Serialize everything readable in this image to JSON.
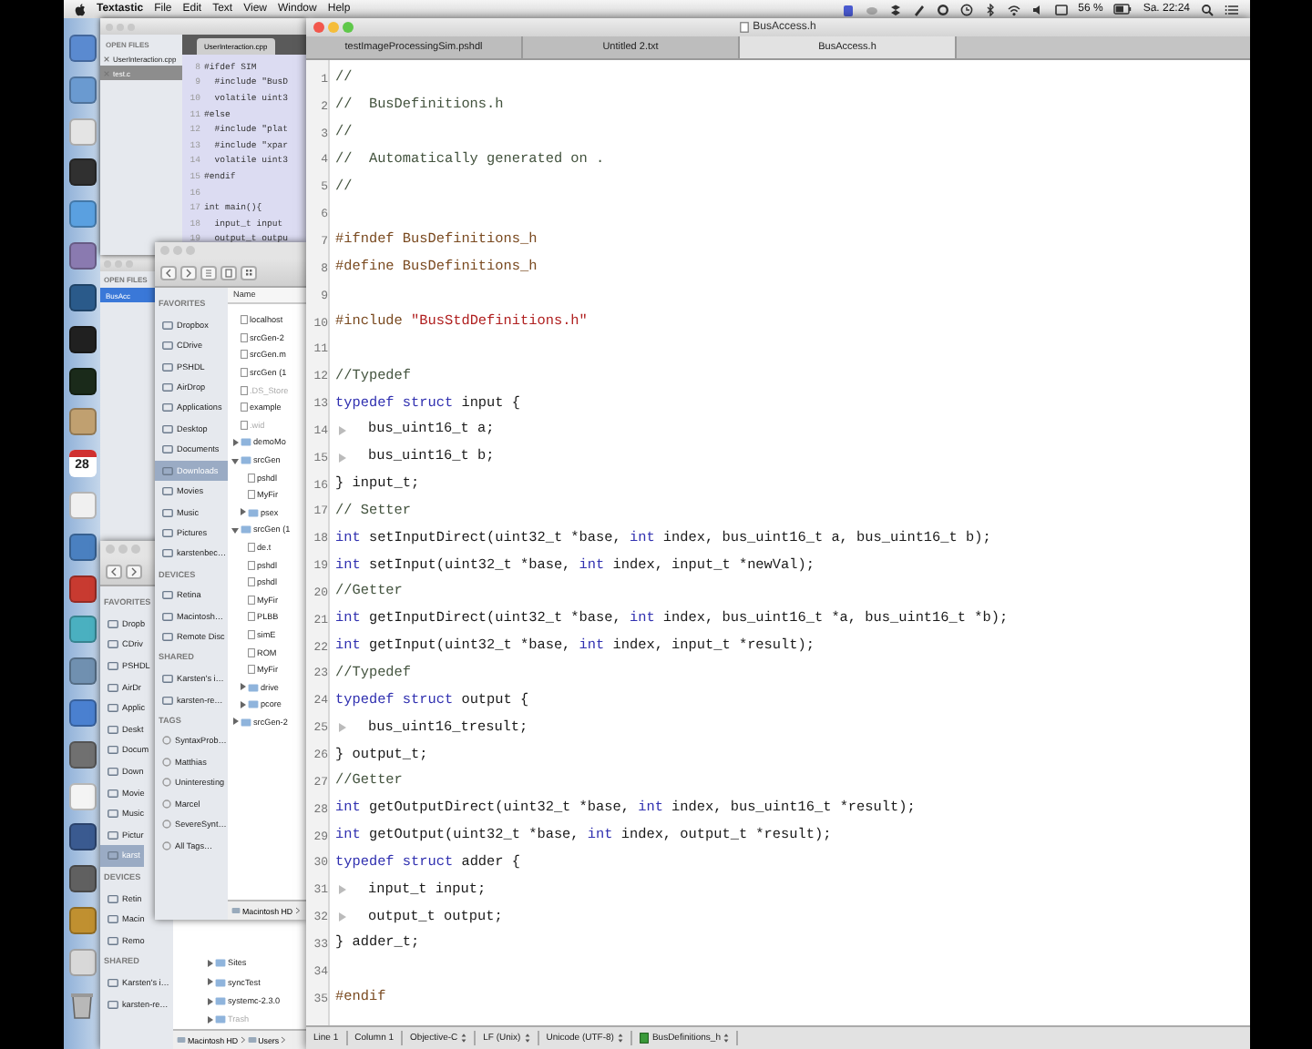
{
  "menu_bar": {
    "app": "Textastic",
    "menus": [
      "File",
      "Edit",
      "Text",
      "View",
      "Window",
      "Help"
    ],
    "battery": "56 %",
    "clock": "Sa. 22:24"
  },
  "dock": {
    "items": [
      {
        "kind": "app",
        "color": "#5a8ad0"
      },
      {
        "kind": "app",
        "color": "#6a9ad0"
      },
      {
        "kind": "app",
        "color": "#e4e4e4"
      },
      {
        "kind": "app",
        "color": "#303030"
      },
      {
        "kind": "app",
        "color": "#5aa0e0"
      },
      {
        "kind": "app",
        "color": "#8a7ab0"
      },
      {
        "kind": "app",
        "color": "#2a5a8a"
      },
      {
        "kind": "app",
        "color": "#202020"
      },
      {
        "kind": "app",
        "color": "#1a2a1a"
      },
      {
        "kind": "app",
        "color": "#c0a070"
      },
      {
        "kind": "calendar",
        "color": "#d03030",
        "text": "28"
      },
      {
        "kind": "app",
        "color": "#f0f0f0"
      },
      {
        "kind": "app",
        "color": "#4a80c0"
      },
      {
        "kind": "app",
        "color": "#c83a30"
      },
      {
        "kind": "app",
        "color": "#4ab0c0"
      },
      {
        "kind": "app",
        "color": "#7090b0"
      },
      {
        "kind": "app",
        "color": "#4a80d0"
      },
      {
        "kind": "app",
        "color": "#707070"
      },
      {
        "kind": "app",
        "color": "#f4f4f4"
      },
      {
        "kind": "app",
        "color": "#3a5a90"
      },
      {
        "kind": "app",
        "color": "#606060"
      },
      {
        "kind": "app",
        "color": "#c09030"
      },
      {
        "kind": "app",
        "color": "#d8d8d8"
      },
      {
        "kind": "trash",
        "color": "#b8b8b8"
      }
    ]
  },
  "background_editor": {
    "sidebar_title": "OPEN FILES",
    "open_files": [
      {
        "name": "UserInteraction.cpp",
        "selected": false
      },
      {
        "name": "test.c",
        "selected": true
      }
    ],
    "tab": "UserInteraction.cpp",
    "lines": [
      {
        "number": "8",
        "text": "#ifdef SIM"
      },
      {
        "number": "9",
        "text": "  #include \"BusD"
      },
      {
        "number": "10",
        "text": "  volatile uint3"
      },
      {
        "number": "11",
        "text": "#else"
      },
      {
        "number": "12",
        "text": "  #include \"plat"
      },
      {
        "number": "13",
        "text": "  #include \"xpar"
      },
      {
        "number": "14",
        "text": "  volatile uint3"
      },
      {
        "number": "15",
        "text": "#endif"
      },
      {
        "number": "16"
      },
      {
        "number": "17",
        "text": "int main(){"
      },
      {
        "number": "18",
        "text": "  input_t input"
      },
      {
        "number": "19",
        "text": "  output_t outpu"
      }
    ]
  },
  "side_window": {
    "sidebar_title": "OPEN FILES",
    "open_files": [
      {
        "name": "BusAcc",
        "selected": true
      }
    ]
  },
  "finder_back": {
    "sections": [
      {
        "title": "FAVORITES",
        "kind": "places",
        "items": [
          {
            "name": "Dropb",
            "selected": false
          },
          {
            "name": "CDriv",
            "selected": false
          },
          {
            "name": "PSHDL",
            "selected": false
          },
          {
            "name": "AirDr",
            "selected": false
          },
          {
            "name": "Applic",
            "selected": false
          },
          {
            "name": "Deskt",
            "selected": false
          },
          {
            "name": "Docum",
            "selected": false
          },
          {
            "name": "Down",
            "selected": false
          },
          {
            "name": "Movie",
            "selected": false
          },
          {
            "name": "Music",
            "selected": false
          },
          {
            "name": "Pictur",
            "selected": false
          },
          {
            "name": "karst",
            "selected": true
          }
        ]
      },
      {
        "title": "DEVICES",
        "kind": "places",
        "items": [
          {
            "name": "Retin",
            "selected": false
          },
          {
            "name": "Macin",
            "selected": false
          },
          {
            "name": "Remo",
            "selected": false
          }
        ]
      },
      {
        "title": "SHARED",
        "kind": "places",
        "items": [
          {
            "name": "Karsten's i…",
            "selected": false
          },
          {
            "name": "karsten-re…",
            "selected": false
          }
        ]
      }
    ],
    "files": [
      {
        "name": "Sites",
        "kind": "folder",
        "expanded": false,
        "dimmed": false
      },
      {
        "name": "syncTest",
        "kind": "folder",
        "expanded": false,
        "dimmed": false
      },
      {
        "name": "systemc-2.3.0",
        "kind": "folder",
        "expanded": false,
        "dimmed": false
      },
      {
        "name": "Trash",
        "kind": "folder",
        "expanded": false,
        "dimmed": true
      }
    ],
    "path": [
      "Macintosh HD",
      "Users"
    ]
  },
  "finder_front": {
    "sections": [
      {
        "title": "FAVORITES",
        "kind": "places",
        "items": [
          {
            "name": "Dropbox",
            "selected": false
          },
          {
            "name": "CDrive",
            "selected": false
          },
          {
            "name": "PSHDL",
            "selected": false
          },
          {
            "name": "AirDrop",
            "selected": false
          },
          {
            "name": "Applications",
            "selected": false
          },
          {
            "name": "Desktop",
            "selected": false
          },
          {
            "name": "Documents",
            "selected": false
          },
          {
            "name": "Downloads",
            "selected": true
          },
          {
            "name": "Movies",
            "selected": false
          },
          {
            "name": "Music",
            "selected": false
          },
          {
            "name": "Pictures",
            "selected": false
          },
          {
            "name": "karstenbec…",
            "selected": false
          }
        ]
      },
      {
        "title": "DEVICES",
        "kind": "places",
        "items": [
          {
            "name": "Retina",
            "selected": false
          },
          {
            "name": "Macintosh…",
            "selected": false
          },
          {
            "name": "Remote Disc",
            "selected": false
          }
        ]
      },
      {
        "title": "SHARED",
        "kind": "places",
        "items": [
          {
            "name": "Karsten's i…",
            "selected": false
          },
          {
            "name": "karsten-re…",
            "selected": false
          }
        ]
      },
      {
        "title": "TAGS",
        "kind": "tags",
        "items": [
          {
            "name": "SyntaxProb…",
            "selected": false
          },
          {
            "name": "Matthias",
            "selected": false
          },
          {
            "name": "Uninteresting",
            "selected": false
          },
          {
            "name": "Marcel",
            "selected": false
          },
          {
            "name": "SevereSynt…",
            "selected": false
          },
          {
            "name": "All Tags…",
            "selected": false
          }
        ]
      }
    ],
    "column_header": "Name",
    "files": [
      {
        "name": "localhost",
        "kind": "file",
        "dimmed": false
      },
      {
        "name": "srcGen-2",
        "kind": "file",
        "dimmed": false
      },
      {
        "name": "srcGen.m",
        "kind": "file",
        "dimmed": false
      },
      {
        "name": "srcGen (1",
        "kind": "file",
        "dimmed": false
      },
      {
        "name": ".DS_Store",
        "kind": "file",
        "dimmed": true
      },
      {
        "name": "example",
        "kind": "file",
        "dimmed": false
      },
      {
        "name": ".wid",
        "kind": "file",
        "dimmed": true
      },
      {
        "name": "demoMo",
        "kind": "folder",
        "expanded": false,
        "dimmed": false
      },
      {
        "name": "srcGen",
        "kind": "folder",
        "expanded": true,
        "dimmed": false,
        "children": [
          {
            "name": "pshdl",
            "kind": "file",
            "dimmed": false
          },
          {
            "name": "MyFir",
            "kind": "file",
            "dimmed": false
          },
          {
            "name": "psex",
            "kind": "folder",
            "expanded": false,
            "dimmed": false
          }
        ]
      },
      {
        "name": "srcGen (1",
        "kind": "folder",
        "expanded": true,
        "dimmed": false,
        "children": [
          {
            "name": "de.t",
            "kind": "file",
            "dimmed": false
          },
          {
            "name": "pshdl",
            "kind": "file",
            "dimmed": false
          },
          {
            "name": "pshdl",
            "kind": "file",
            "dimmed": false
          },
          {
            "name": "MyFir",
            "kind": "file",
            "dimmed": false
          },
          {
            "name": "PLBB",
            "kind": "file",
            "dimmed": false
          },
          {
            "name": "simE",
            "kind": "file",
            "dimmed": false
          },
          {
            "name": "ROM",
            "kind": "file",
            "dimmed": false
          },
          {
            "name": "MyFir",
            "kind": "file",
            "dimmed": false
          },
          {
            "name": "drive",
            "kind": "folder",
            "expanded": false,
            "dimmed": false
          },
          {
            "name": "pcore",
            "kind": "folder",
            "expanded": false,
            "dimmed": false
          }
        ]
      },
      {
        "name": "srcGen-2",
        "kind": "folder",
        "expanded": false,
        "dimmed": false
      }
    ],
    "path": [
      "Macintosh HD"
    ]
  },
  "editor": {
    "title": "BusAccess.h",
    "tabs": [
      {
        "label": "testImageProcessingSim.pshdl",
        "selected": false
      },
      {
        "label": "Untitled 2.txt",
        "selected": false
      },
      {
        "label": "BusAccess.h",
        "selected": true
      }
    ],
    "lines": [
      {
        "number": "1",
        "indented": false,
        "tokens": [
          {
            "kind": "comment",
            "text": "//"
          }
        ]
      },
      {
        "number": "2",
        "indented": false,
        "tokens": [
          {
            "kind": "comment",
            "text": "//  BusDefinitions.h"
          }
        ]
      },
      {
        "number": "3",
        "indented": false,
        "tokens": [
          {
            "kind": "comment",
            "text": "//"
          }
        ]
      },
      {
        "number": "4",
        "indented": false,
        "tokens": [
          {
            "kind": "comment",
            "text": "//  Automatically generated on ."
          }
        ]
      },
      {
        "number": "5",
        "indented": false,
        "tokens": [
          {
            "kind": "comment",
            "text": "//"
          }
        ]
      },
      {
        "number": "6",
        "indented": false
      },
      {
        "number": "7",
        "indented": false,
        "tokens": [
          {
            "kind": "preproc",
            "text": "#ifndef BusDefinitions_h"
          }
        ]
      },
      {
        "number": "8",
        "indented": false,
        "tokens": [
          {
            "kind": "preproc",
            "text": "#define BusDefinitions_h"
          }
        ]
      },
      {
        "number": "9",
        "indented": false
      },
      {
        "number": "10",
        "indented": false,
        "tokens": [
          {
            "kind": "preproc",
            "text": "#include "
          },
          {
            "kind": "string",
            "text": "\"BusStdDefinitions.h\""
          }
        ]
      },
      {
        "number": "11",
        "indented": false
      },
      {
        "number": "12",
        "indented": false,
        "tokens": [
          {
            "kind": "comment",
            "text": "//Typedef"
          }
        ]
      },
      {
        "number": "13",
        "indented": false,
        "tokens": [
          {
            "kind": "keyword",
            "text": "typedef struct"
          },
          {
            "kind": "plain",
            "text": " input {"
          }
        ]
      },
      {
        "number": "14",
        "indented": true,
        "tokens": [
          {
            "kind": "plain",
            "text": "bus_uint16_t a;"
          }
        ]
      },
      {
        "number": "15",
        "indented": true,
        "tokens": [
          {
            "kind": "plain",
            "text": "bus_uint16_t b;"
          }
        ]
      },
      {
        "number": "16",
        "indented": false,
        "tokens": [
          {
            "kind": "plain",
            "text": "} input_t;"
          }
        ]
      },
      {
        "number": "17",
        "indented": false,
        "tokens": [
          {
            "kind": "comment",
            "text": "// Setter"
          }
        ]
      },
      {
        "number": "18",
        "indented": false,
        "tokens": [
          {
            "kind": "keyword",
            "text": "int"
          },
          {
            "kind": "plain",
            "text": " setInputDirect(uint32_t *base, "
          },
          {
            "kind": "keyword",
            "text": "int"
          },
          {
            "kind": "plain",
            "text": " index, bus_uint16_t a, bus_uint16_t b);"
          }
        ]
      },
      {
        "number": "19",
        "indented": false,
        "tokens": [
          {
            "kind": "keyword",
            "text": "int"
          },
          {
            "kind": "plain",
            "text": " setInput(uint32_t *base, "
          },
          {
            "kind": "keyword",
            "text": "int"
          },
          {
            "kind": "plain",
            "text": " index, input_t *newVal);"
          }
        ]
      },
      {
        "number": "20",
        "indented": false,
        "tokens": [
          {
            "kind": "comment",
            "text": "//Getter"
          }
        ]
      },
      {
        "number": "21",
        "indented": false,
        "tokens": [
          {
            "kind": "keyword",
            "text": "int"
          },
          {
            "kind": "plain",
            "text": " getInputDirect(uint32_t *base, "
          },
          {
            "kind": "keyword",
            "text": "int"
          },
          {
            "kind": "plain",
            "text": " index, bus_uint16_t *a, bus_uint16_t *b);"
          }
        ]
      },
      {
        "number": "22",
        "indented": false,
        "tokens": [
          {
            "kind": "keyword",
            "text": "int"
          },
          {
            "kind": "plain",
            "text": " getInput(uint32_t *base, "
          },
          {
            "kind": "keyword",
            "text": "int"
          },
          {
            "kind": "plain",
            "text": " index, input_t *result);"
          }
        ]
      },
      {
        "number": "23",
        "indented": false,
        "tokens": [
          {
            "kind": "comment",
            "text": "//Typedef"
          }
        ]
      },
      {
        "number": "24",
        "indented": false,
        "tokens": [
          {
            "kind": "keyword",
            "text": "typedef struct"
          },
          {
            "kind": "plain",
            "text": " output {"
          }
        ]
      },
      {
        "number": "25",
        "indented": true,
        "tokens": [
          {
            "kind": "plain",
            "text": "bus_uint16_tresult;"
          }
        ]
      },
      {
        "number": "26",
        "indented": false,
        "tokens": [
          {
            "kind": "plain",
            "text": "} output_t;"
          }
        ]
      },
      {
        "number": "27",
        "indented": false,
        "tokens": [
          {
            "kind": "comment",
            "text": "//Getter"
          }
        ]
      },
      {
        "number": "28",
        "indented": false,
        "tokens": [
          {
            "kind": "keyword",
            "text": "int"
          },
          {
            "kind": "plain",
            "text": " getOutputDirect(uint32_t *base, "
          },
          {
            "kind": "keyword",
            "text": "int"
          },
          {
            "kind": "plain",
            "text": " index, bus_uint16_t *result);"
          }
        ]
      },
      {
        "number": "29",
        "indented": false,
        "tokens": [
          {
            "kind": "keyword",
            "text": "int"
          },
          {
            "kind": "plain",
            "text": " getOutput(uint32_t *base, "
          },
          {
            "kind": "keyword",
            "text": "int"
          },
          {
            "kind": "plain",
            "text": " index, output_t *result);"
          }
        ]
      },
      {
        "number": "30",
        "indented": false,
        "tokens": [
          {
            "kind": "keyword",
            "text": "typedef struct"
          },
          {
            "kind": "plain",
            "text": " adder {"
          }
        ]
      },
      {
        "number": "31",
        "indented": true,
        "tokens": [
          {
            "kind": "plain",
            "text": "input_t input;"
          }
        ]
      },
      {
        "number": "32",
        "indented": true,
        "tokens": [
          {
            "kind": "plain",
            "text": "output_t output;"
          }
        ]
      },
      {
        "number": "33",
        "indented": false,
        "tokens": [
          {
            "kind": "plain",
            "text": "} adder_t;"
          }
        ]
      },
      {
        "number": "34",
        "indented": false
      },
      {
        "number": "35",
        "indented": false,
        "tokens": [
          {
            "kind": "preproc",
            "text": "#endif"
          }
        ]
      }
    ],
    "status_bar": [
      {
        "kind": "label",
        "text": "Line 1"
      },
      {
        "kind": "label",
        "text": "Column 1"
      },
      {
        "kind": "popup",
        "text": "Objective-C"
      },
      {
        "kind": "popup",
        "text": "LF (Unix)"
      },
      {
        "kind": "popup",
        "text": "Unicode (UTF-8)"
      },
      {
        "kind": "symbol",
        "text": "BusDefinitions_h"
      }
    ]
  }
}
